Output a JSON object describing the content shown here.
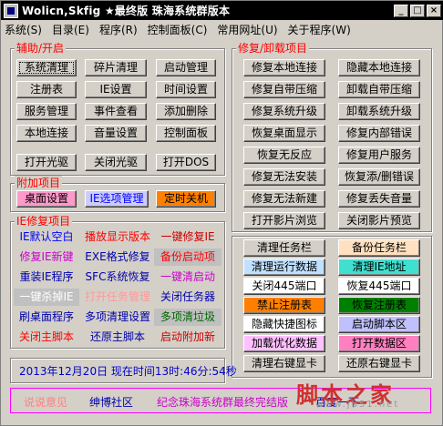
{
  "window": {
    "title": "Wolicn,Skfig ★最终版 珠海系统群版本",
    "min": "_",
    "max": "□",
    "close": "×"
  },
  "menu": [
    "系统(S)",
    "目录(E)",
    "程序(R)",
    "控制面板(C)",
    "常用网址(U)",
    "关于程序(W)"
  ],
  "groups": {
    "assist": "辅助/开启",
    "repair": "修复/卸载项目",
    "extra": "附加项目",
    "ie": "IE修复项目"
  },
  "assist_buttons": [
    "系统清理",
    "碎片清理",
    "启动管理",
    "注册表",
    "IE设置",
    "时间设置",
    "服务管理",
    "事件查看",
    "添加删除",
    "本地连接",
    "音量设置",
    "控制面板",
    "打开光驱",
    "关闭光驱",
    "打开DOS"
  ],
  "extra_buttons": [
    "桌面设置",
    "IE选项管理",
    "定时关机"
  ],
  "ie_items": [
    "IE默认空白",
    "播放显示版本",
    "一键修复IE",
    "修复IE新键",
    "EXE格式修复",
    "备份启动项",
    "重装IE程序",
    "SFC系统恢复",
    "一键清启动",
    "一键杀掉IE",
    "打开任务管理",
    "关闭任务器",
    "刷桌面程序",
    "多项清理设置",
    "多项清垃圾",
    "关闭主脚本",
    "还原主脚本",
    "启动附加新"
  ],
  "repair_buttons": [
    "修复本地连接",
    "隐藏本地连接",
    "修复自带压缩",
    "卸载自带压缩",
    "修复系统升级",
    "卸载系统升级",
    "恢复桌面显示",
    "修复内部错误",
    "恢复无反应",
    "修复用户服务",
    "修复无法安装",
    "恢复添/删错误",
    "修复无法新建",
    "修复丢失音量",
    "打开影片浏览",
    "关闭影片预览"
  ],
  "tool_buttons": [
    "清理任务栏",
    "备份任务栏",
    "清理运行数据",
    "清理IE地址",
    "关闭445端口",
    "恢复445端口",
    "禁止注册表",
    "恢复注册表",
    "隐藏快捷图标",
    "启动脚本区",
    "加载优化数据",
    "打开数据区",
    "清理右键显卡",
    "还原右键显卡"
  ],
  "status": {
    "time": "2013年12月20日 现在时间13时:46分:54秒"
  },
  "footer": {
    "feedback": "说说意见",
    "community": "绅博社区",
    "memorial": "纪念珠海系统群最终完结版",
    "site": "百度一下"
  },
  "watermark": {
    "text": "脚本之家",
    "url": "www.jb51.net"
  },
  "colors": {
    "title_bg": "#000000",
    "group_label": "#ff0000",
    "time_text": "#0000cc",
    "footer_border": "#ff00ff"
  }
}
